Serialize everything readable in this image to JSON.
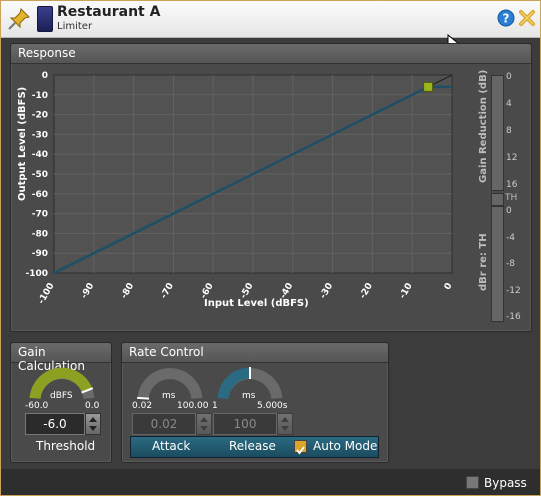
{
  "window": {
    "title": "Restaurant A",
    "subtitle": "Limiter"
  },
  "response": {
    "title": "Response",
    "x_label": "Input Level (dBFS)",
    "y_label": "Output Level (dBFS)",
    "x_ticks": [
      "-100",
      "-90",
      "-80",
      "-70",
      "-60",
      "-50",
      "-40",
      "-30",
      "-20",
      "-10",
      "0"
    ],
    "y_ticks": [
      "0",
      "-10",
      "-20",
      "-30",
      "-40",
      "-50",
      "-60",
      "-70",
      "-80",
      "-90",
      "-100"
    ],
    "gr_label": "Gain Reduction (dB)",
    "gr_ticks": [
      "0",
      "4",
      "8",
      "12",
      "16"
    ],
    "th_label": "TH",
    "dbr_label": "dBr re: TH",
    "dbr_ticks": [
      "0",
      "-4",
      "-8",
      "-12",
      "-16"
    ],
    "threshold_dbfs": -6.0,
    "curve_color": "#1e4f66",
    "handle_color": "#9bb51a"
  },
  "chart_data": {
    "type": "line",
    "title": "",
    "xlabel": "Input Level (dBFS)",
    "ylabel": "Output Level (dBFS)",
    "xlim": [
      -100,
      0
    ],
    "ylim": [
      -100,
      0
    ],
    "x": [
      -100,
      -6,
      0
    ],
    "series": [
      {
        "values": [
          -100,
          -6,
          -6
        ]
      }
    ],
    "grid": true
  },
  "gain_calc": {
    "title": "Gain Calculation",
    "knob_unit": "dBFS",
    "knob_min": "-60.0",
    "knob_max": "0.0",
    "value": "-6.0",
    "label": "Threshold",
    "knob_fraction": 0.9
  },
  "rate_control": {
    "title": "Rate Control",
    "attack": {
      "unit": "ms",
      "min": "0.02",
      "max": "100.00",
      "value": "0.02",
      "label": "Attack",
      "knob_fraction": 0.0
    },
    "release": {
      "unit": "ms",
      "min": "1",
      "max": "5.000s",
      "value": "100",
      "label": "Release",
      "knob_fraction": 0.5
    },
    "auto_mode_label": "Auto Mode",
    "auto_mode_checked": true
  },
  "bypass": {
    "label": "Bypass",
    "checked": false
  }
}
